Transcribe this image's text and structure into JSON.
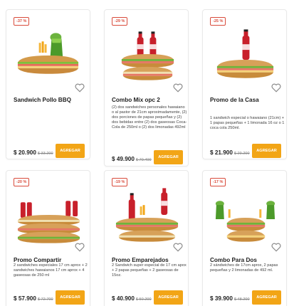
{
  "labels": {
    "add_button": "AGREGAR"
  },
  "colors": {
    "accent": "#f2a516",
    "badge": "#d94b3b"
  },
  "products": [
    {
      "discount": "-37 %",
      "name": "Sandwich Pollo BBQ",
      "description": "",
      "price": "$ 20.900",
      "old_price": "$ 33.200",
      "image": "sandwich-with-drink-and-fries"
    },
    {
      "discount": "-29 %",
      "name": "Combo Mix opc 2",
      "description": "(2) dos sandwiches personales hawaiano o al pastor de 21cm aproximadamente, (2) dos porciones de papas pequeñas y (2) dos bebidas entre (2) dos gaseosas Coca-Cola de 250ml o (2) dos limonadas 492ml",
      "price": "$ 49.900",
      "old_price": "$ 70.400",
      "image": "two-sandwiches-two-cokes"
    },
    {
      "discount": "-25 %",
      "name": "Promo de la Casa",
      "description": "1 sandwich especial o hawaiano (21cm) + 1 papas pequeñas + 1 limonada 16 oz o 1 coca cola 250ml.",
      "price": "$ 21.900",
      "old_price": "$ 29.200",
      "image": "sandwich-with-coke"
    },
    {
      "discount": "-20 %",
      "name": "Promo Compartir",
      "description": "2 sandwiches especiales 17 cm aprox + 2 sandwiches hawaianos 17 cm aprox + 4 gaseosas de 250 ml",
      "price": "$ 57.900",
      "old_price": "$ 72.700",
      "image": "four-sandwiches-four-cokes"
    },
    {
      "discount": "-19 %",
      "name": "Promo Emparejados",
      "description": "2 Sandwich super especial de 17 cm apox + 2 papas pequeñas + 2 gaseosas de 15oz.",
      "price": "$ 40.900",
      "old_price": "$ 50.200",
      "image": "two-sandwiches-two-cokes"
    },
    {
      "discount": "-17 %",
      "name": "Combo Para Dos",
      "description": "2 sándwiches de 17cm aprox, 2 papas pequeñas y 2 limonadas de 492 ml.",
      "price": "$ 39.900",
      "old_price": "$ 48.200",
      "image": "two-sandwiches-two-lemonades"
    }
  ]
}
